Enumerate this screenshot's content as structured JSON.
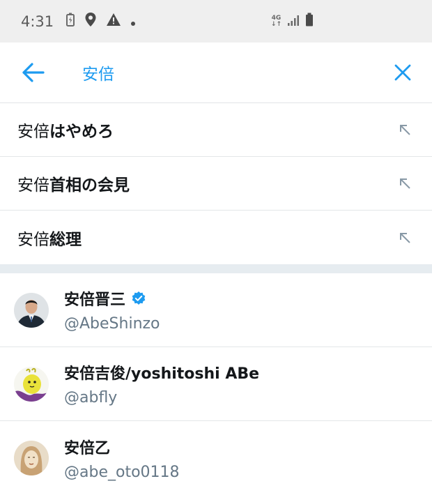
{
  "status_bar": {
    "time": "4:31",
    "network_top": "4G",
    "network_bottom": "↓↑"
  },
  "search": {
    "query": "安倍"
  },
  "suggestions": [
    {
      "prefix": "安倍",
      "suffix": "はやめろ"
    },
    {
      "prefix": "安倍",
      "suffix": "首相の会見"
    },
    {
      "prefix": "安倍",
      "suffix": "総理"
    }
  ],
  "users": [
    {
      "name": "安倍晋三",
      "handle": "@AbeShinzo",
      "verified": true
    },
    {
      "name": "安倍吉俊/yoshitoshi ABe",
      "handle": "@abfly",
      "verified": false
    },
    {
      "name": "安倍乙",
      "handle": "@abe_oto0118",
      "verified": false
    }
  ],
  "colors": {
    "accent": "#1d9bf0",
    "secondary_text": "#657786",
    "separator": "#e6ecf0"
  }
}
